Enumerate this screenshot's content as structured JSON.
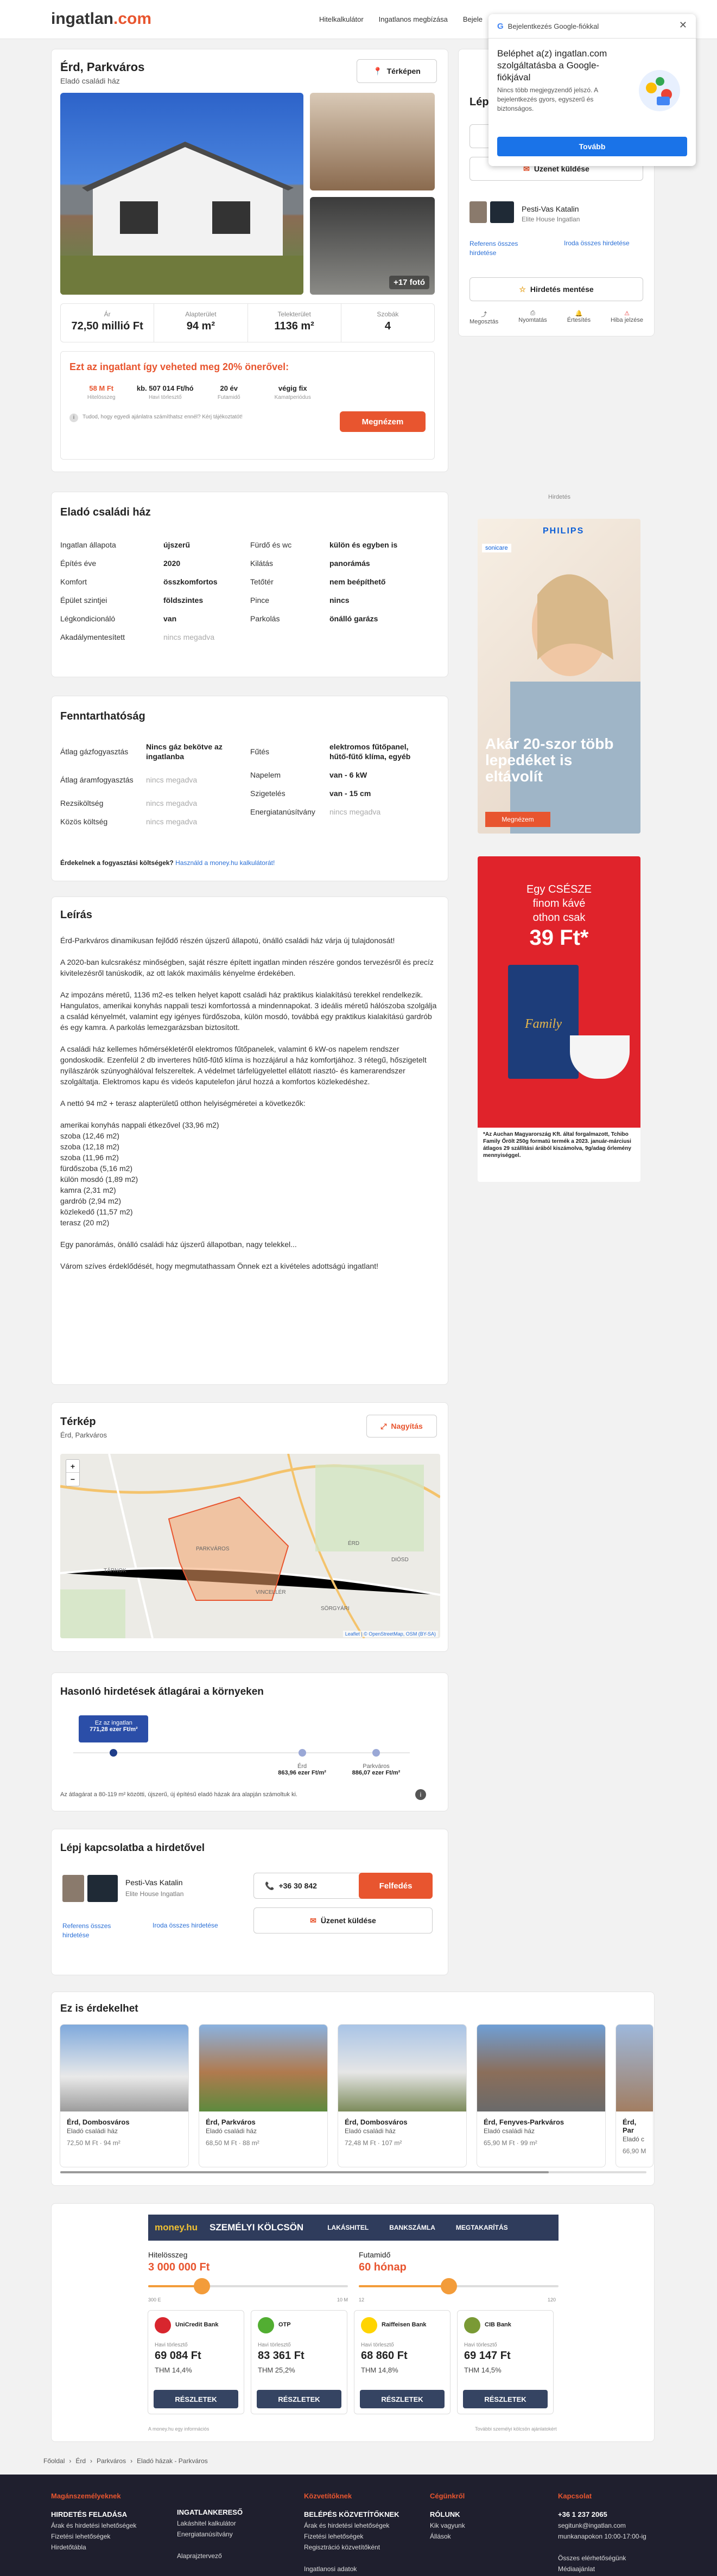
{
  "header": {
    "logo_main": "ingatlan",
    "logo_tld": ".com",
    "nav": [
      "Hitelkalkulátor",
      "Ingatlanos megbízása",
      "Bejele"
    ]
  },
  "google_popup": {
    "brand": "Bejelentkezés Google-fiókkal",
    "title": "Beléphet a(z) ingatlan.com szolgáltatásba a Google-fiókjával",
    "text": "Nincs több megjegyzendő jelszó. A bejelentkezés gyors, egyszerű és biztonságos.",
    "button": "Tovább"
  },
  "listing": {
    "title": "Érd, Parkváros",
    "subtitle": "Eladó családi ház",
    "map_button": "Térképen",
    "photo_count": "+17 fotó",
    "stats": [
      {
        "label": "Ár",
        "value": "72,50 millió Ft"
      },
      {
        "label": "Alapterület",
        "value": "94 m²"
      },
      {
        "label": "Telekterület",
        "value": "1136 m²"
      },
      {
        "label": "Szobák",
        "value": "4"
      }
    ],
    "promo_title": "Ezt az ingatlant így veheted meg 20% önerővel:",
    "promo": [
      {
        "value": "58 M Ft",
        "label": "Hitelösszeg"
      },
      {
        "value": "kb. 507 014 Ft/hó",
        "label": "Havi törlesztő"
      },
      {
        "value": "20 év",
        "label": "Futamidő"
      },
      {
        "value": "végig fix",
        "label": "Kamatperiódus"
      }
    ],
    "promo_note": "Tudod, hogy egyedi ajánlatra számíthatsz ennél? Kérj tájékoztatót!",
    "promo_button": "Megnézem"
  },
  "contact": {
    "title": "Lép",
    "message_button": "Üzenet küldése",
    "agent_name": "Pesti-Vas Katalin",
    "agent_company": "Elite House Ingatlan",
    "agent_link_1": "Referens összes hirdetése",
    "agent_link_2": "Iroda összes hirdetése",
    "save_button": "Hirdetés mentése",
    "actions": [
      "Megosztás",
      "Nyomtatás",
      "Értesítés",
      "Hiba jelzése"
    ]
  },
  "ads": {
    "label": "Hirdetés",
    "philips_brand": "PHILIPS",
    "philips_sub": "sonicare",
    "philips_headline": "Akár 20-szor több lepedéket is eltávolít",
    "philips_button": "Megnézem",
    "tchibo_l1": "Egy CSÉSZE",
    "tchibo_l2": "finom kávé",
    "tchibo_l3": "othon csak",
    "tchibo_price": "39 Ft*",
    "tchibo_product": "Family",
    "tchibo_note": "*Az Auchan Magyarország Kft. által forgalmazott, Tchibo Family Őrölt 250g formatú termék a 2023. január-márciusi átlagos 29 szállítási árából kiszámolva, 9g/adag őrlemény mennyiséggel."
  },
  "details": {
    "title": "Eladó családi ház",
    "left": [
      {
        "k": "Ingatlan állapota",
        "v": "újszerű"
      },
      {
        "k": "Építés éve",
        "v": "2020"
      },
      {
        "k": "Komfort",
        "v": "összkomfortos"
      },
      {
        "k": "Épület szintjei",
        "v": "földszintes"
      },
      {
        "k": "Légkondicionáló",
        "v": "van"
      },
      {
        "k": "Akadálymentesített",
        "v": "nincs megadva",
        "na": true
      }
    ],
    "right": [
      {
        "k": "Fürdő és wc",
        "v": "külön és egyben is"
      },
      {
        "k": "Kilátás",
        "v": "panorámás"
      },
      {
        "k": "Tetőtér",
        "v": "nem beépíthető"
      },
      {
        "k": "Pince",
        "v": "nincs"
      },
      {
        "k": "Parkolás",
        "v": "önálló garázs"
      }
    ]
  },
  "upkeep": {
    "title": "Fenntarthatóság",
    "left": [
      {
        "k": "Átlag gázfogyasztás",
        "v": "Nincs gáz bekötve az ingatlanba"
      },
      {
        "k": "Átlag áramfogyasztás",
        "v": "nincs megadva",
        "na": true
      },
      {
        "k": "Rezsiköltség",
        "v": "nincs megadva",
        "na": true
      },
      {
        "k": "Közös költség",
        "v": "nincs megadva",
        "na": true
      }
    ],
    "right": [
      {
        "k": "Fűtés",
        "v": "elektromos fűtőpanel, hűtő-fűtő klíma, egyéb"
      },
      {
        "k": "Napelem",
        "v": "van - 6 kW"
      },
      {
        "k": "Szigetelés",
        "v": "van - 15 cm"
      },
      {
        "k": "Energiatanúsítvány",
        "v": "nincs megadva",
        "na": true
      }
    ],
    "question": "Érdekelnek a fogyasztási költségek?",
    "question_link": "Használd a money.hu kalkulátorát!"
  },
  "description": {
    "title": "Leírás",
    "paragraphs": [
      "Érd-Parkváros dinamikusan fejlődő részén újszerű állapotú, önálló családi ház várja új tulajdonosát!",
      "A 2020-ban kulcsrakész minőségben, saját részre épített ingatlan minden részére gondos tervezésről és precíz kivitelezésről tanúskodik, az ott lakók maximális kényelme érdekében.",
      "Az impozáns méretű, 1136 m2-es telken helyet kapott családi ház praktikus kialakítású terekkel rendelkezik. Hangulatos, amerikai konyhás nappali teszi komfortossá a mindennapokat. 3 ideális méretű hálószoba szolgálja a család kényelmét, valamint egy igényes fürdőszoba, külön mosdó, továbbá egy praktikus kialakítású gardrób és egy kamra. A parkolás lemezgarázsban biztosított.",
      "A családi ház kellemes hőmérsékletéről elektromos fűtőpanelek, valamint 6 kW-os napelem rendszer gondoskodik. Ezenfelül 2 db inverteres hűtő-fűtő klíma is hozzájárul a ház komfortjához. 3 rétegű, hőszigetelt nyílászárók szúnyoghálóval felszereltek. A védelmet tárfelügyelettel ellátott riasztó- és kamerarendszer szolgáltatja. Elektromos kapu és videós kaputelefon járul hozzá a komfortos közlekedéshez.",
      "A nettó 94 m2 + terasz alapterületű otthon helyiségméretei a következők:"
    ],
    "rooms": [
      "amerikai konyhás nappali étkezővel (33,96 m2)",
      "szoba (12,46 m2)",
      "szoba (12,18 m2)",
      "szoba (11,96 m2)",
      "fürdőszoba (5,16 m2)",
      "külön mosdó (1,89 m2)",
      "kamra (2,31 m2)",
      "gardrób (2,94 m2)",
      "közlekedő (11,57 m2)",
      "terasz (20 m2)"
    ],
    "closing_1": "Egy panorámás, önálló családi ház újszerű állapotban, nagy telekkel...",
    "closing_2": "Várom szíves érdeklődését, hogy megmutathassam Önnek ezt a kivételes adottságú ingatlant!"
  },
  "map": {
    "title": "Térkép",
    "subtitle": "Érd, Parkváros",
    "expand": "Nagyítás",
    "zoom_in": "+",
    "zoom_out": "−",
    "labels": [
      "PARKVÁROS",
      "TÁRNOK",
      "DIÓSD",
      "VINCELLÉR",
      "ÉRD",
      "SÖRGYÁRI"
    ],
    "attribution": "Leaflet | © OpenStreetMap, OSM (BY-SA)"
  },
  "price_compare": {
    "title": "Hasonló hirdetések átlagárai a környeken",
    "tag_l1": "Ez az ingatlan",
    "tag_l2": "771,28 ezer Ft/m²",
    "points": [
      {
        "place": "Érd",
        "value": "863,96 ezer Ft/m²",
        "pos": 0.68
      },
      {
        "place": "Parkváros",
        "value": "886,07 ezer Ft/m²",
        "pos": 0.9
      }
    ],
    "this_pos": 0.12,
    "note": "Az átlagárat a 80-119 m² közötti, újszerű, új építésű eladó házak ára alapján számoltuk ki."
  },
  "contact2": {
    "title": "Lépj kapcsolatba a hirdetővel",
    "agent_name": "Pesti-Vas Katalin",
    "agent_company": "Elite House Ingatlan",
    "link_1": "Referens összes hirdetése",
    "link_2": "Iroda összes hirdetése",
    "phone": "+36 30 842",
    "reveal": "Felfedés",
    "message": "Üzenet küldése"
  },
  "similar": {
    "title": "Ez is érdekelhet",
    "items": [
      {
        "t": "Érd, Dombosváros",
        "s": "Eladó családi ház",
        "p": "72,50 M Ft  ·  94 m²"
      },
      {
        "t": "Érd, Parkváros",
        "s": "Eladó családi ház",
        "p": "68,50 M Ft  ·  88 m²"
      },
      {
        "t": "Érd, Dombosváros",
        "s": "Eladó családi ház",
        "p": "72,48 M Ft  ·  107 m²"
      },
      {
        "t": "Érd, Fenyves-Parkváros",
        "s": "Eladó családi ház",
        "p": "65,90 M Ft  ·  99 m²"
      },
      {
        "t": "Érd, Par",
        "s": "Eladó c",
        "p": "66,90 M"
      }
    ]
  },
  "loan": {
    "brand": "money.hu",
    "product": "SZEMÉLYI KÖLCSÖN",
    "tabs": [
      "LAKÁSHITEL",
      "BANKSZÁMLA",
      "MEGTAKARÍTÁS"
    ],
    "amount_label": "Hitelösszeg",
    "amount_value": "3 000 000 Ft",
    "term_label": "Futamidő",
    "term_value": "60 hónap",
    "amount_min": "300 E",
    "amount_max": "10 M",
    "term_min": "12",
    "term_max": "120",
    "amount_frac": 0.27,
    "term_frac": 0.45,
    "sublabel": "Havi törlesztő",
    "banks": [
      {
        "name": "UniCredit Bank",
        "amount": "69 084 Ft",
        "thm": "THM 14,4%",
        "color": "#d8262e"
      },
      {
        "name": "OTP",
        "amount": "83 361 Ft",
        "thm": "THM 25,2%",
        "color": "#52ae32"
      },
      {
        "name": "Raiffeisen Bank",
        "amount": "68 860 Ft",
        "thm": "THM 14,8%",
        "color": "#ffd400"
      },
      {
        "name": "CIB Bank",
        "amount": "69 147 Ft",
        "thm": "THM 14,5%",
        "color": "#7a9a35"
      }
    ],
    "card_button": "RÉSZLETEK",
    "note_left": "A money.hu egy információs",
    "note_right": "További személyi kölcsön ajánlatokért"
  },
  "breadcrumb": [
    "Főoldal",
    "Érd",
    "Parkváros",
    "Eladó házak - Parkváros"
  ],
  "footer": {
    "cols": [
      {
        "tag": "Magánszemélyeknek",
        "head": "HIRDETÉS FELADÁSA",
        "items": [
          "Árak és hirdetési lehetőségek",
          "Fizetési lehetőségek",
          "Hirdetőtábla"
        ]
      },
      {
        "tag": "",
        "head": "INGATLANKERESŐ",
        "items": [
          "Lakáshitel kalkulátor",
          "Energiatanúsítvány",
          "",
          "Alaprajztervező"
        ]
      },
      {
        "tag": "Közvetítőknek",
        "head": "BELÉPÉS KÖZVETÍTŐKNEK",
        "items": [
          "Árak és hirdetési lehetőségek",
          "Fizetési lehetőségek",
          "Regisztráció közvetítőként",
          "",
          "Ingatlanosi adatok"
        ]
      },
      {
        "tag": "Cégünkről",
        "head": "RÓLUNK",
        "items": [
          "Kik vagyunk",
          "Állások"
        ]
      },
      {
        "tag": "Kapcsolat",
        "head": "+36 1 237 2065",
        "items": [
          "segitunk@ingatlan.com",
          "munkanapokon 10:00-17:00-ig",
          "",
          "Összes elérhetőségünk",
          "Médiaajánlat"
        ]
      }
    ]
  }
}
